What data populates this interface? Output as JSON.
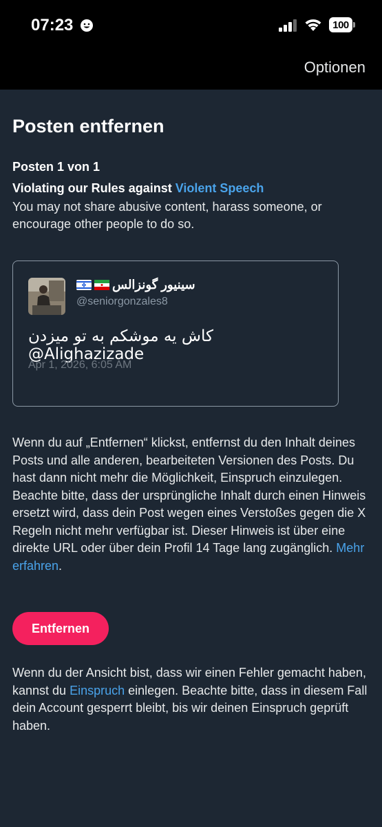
{
  "status_bar": {
    "time": "07:23",
    "battery": "100"
  },
  "topbar": {
    "options_label": "Optionen"
  },
  "page": {
    "title": "Posten entfernen",
    "post_count": "Posten 1 von 1",
    "violation_prefix": "Violating our Rules against ",
    "violation_link": "Violent Speech",
    "violation_text": "You may not share abusive content, harass someone, or encourage other people to do so."
  },
  "tweet": {
    "display_name": "سینیور گونزالس",
    "handle": "@seniorgonzales8",
    "text": "کاش یه موشکم به تو میزدن @Alighazizade",
    "date": "Apr 1, 2026, 6:05 AM"
  },
  "removal": {
    "text": "Wenn du auf „Entfernen“ klickst, entfernst du den Inhalt deines Posts und alle anderen, bearbeiteten Versionen des Posts. Du hast dann nicht mehr die Möglichkeit, Einspruch einzulegen. Beachte bitte, dass der ursprüngliche Inhalt durch einen Hinweis ersetzt wird, dass dein Post wegen eines Verstoßes gegen die X Regeln nicht mehr verfügbar ist. Dieser Hinweis ist über eine direkte URL oder über dein Profil 14 Tage lang zugänglich. ",
    "link": "Mehr erfahren",
    "suffix": ".",
    "button_label": "Entfernen"
  },
  "appeal": {
    "prefix": "Wenn du der Ansicht bist, dass wir einen Fehler gemacht haben, kannst du ",
    "link": "Einspruch",
    "suffix": " einlegen. Beachte bitte, dass in diesem Fall dein Account gesperrt bleibt, bis wir deinen Einspruch geprüft haben."
  },
  "colors": {
    "background": "#1d2733",
    "accent_link": "#4aa3ea",
    "button": "#f4215e"
  }
}
